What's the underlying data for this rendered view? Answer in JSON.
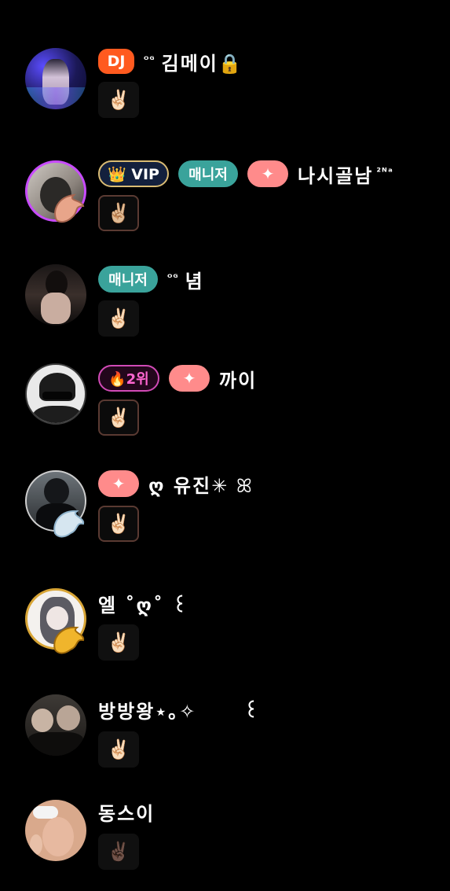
{
  "messages": [
    {
      "badges": [
        "DJ"
      ],
      "name_prefix": "ᴼᴳ",
      "name": "김메이",
      "name_suffix": "🔒",
      "reaction": "✌🏻"
    },
    {
      "badges": [
        "👑 VIP",
        "매니저",
        "✦"
      ],
      "name": "나시골남",
      "name_suffix": "²ᴺᵃ",
      "reaction": "✌🏼"
    },
    {
      "badges": [
        "매니저"
      ],
      "name_prefix": "ᴼᴳ",
      "name": "념",
      "reaction": "✌🏻"
    },
    {
      "badges": [
        "🔥2위",
        "✦"
      ],
      "name": "까이",
      "reaction": "✌🏻"
    },
    {
      "badges": [
        "✦"
      ],
      "name_prefix": "ღ",
      "name": "유진",
      "name_suffix": "✳ ꕤ",
      "reaction": "✌🏻"
    },
    {
      "name": "엘 ˚ღ˚ ꒰",
      "reaction": "✌🏻"
    },
    {
      "name": "방방왕⋆｡✧",
      "name_suffix": "꒰",
      "reaction": "✌🏻"
    },
    {
      "name": "동스이",
      "reaction": "✌🏿"
    }
  ],
  "colors": {
    "background": "#000000",
    "dj": "#ff5a1f",
    "manager": "#3aa39b",
    "spark": "#ff8b8b",
    "vip_border": "#d9bb74",
    "rank": "#ff66d1"
  }
}
